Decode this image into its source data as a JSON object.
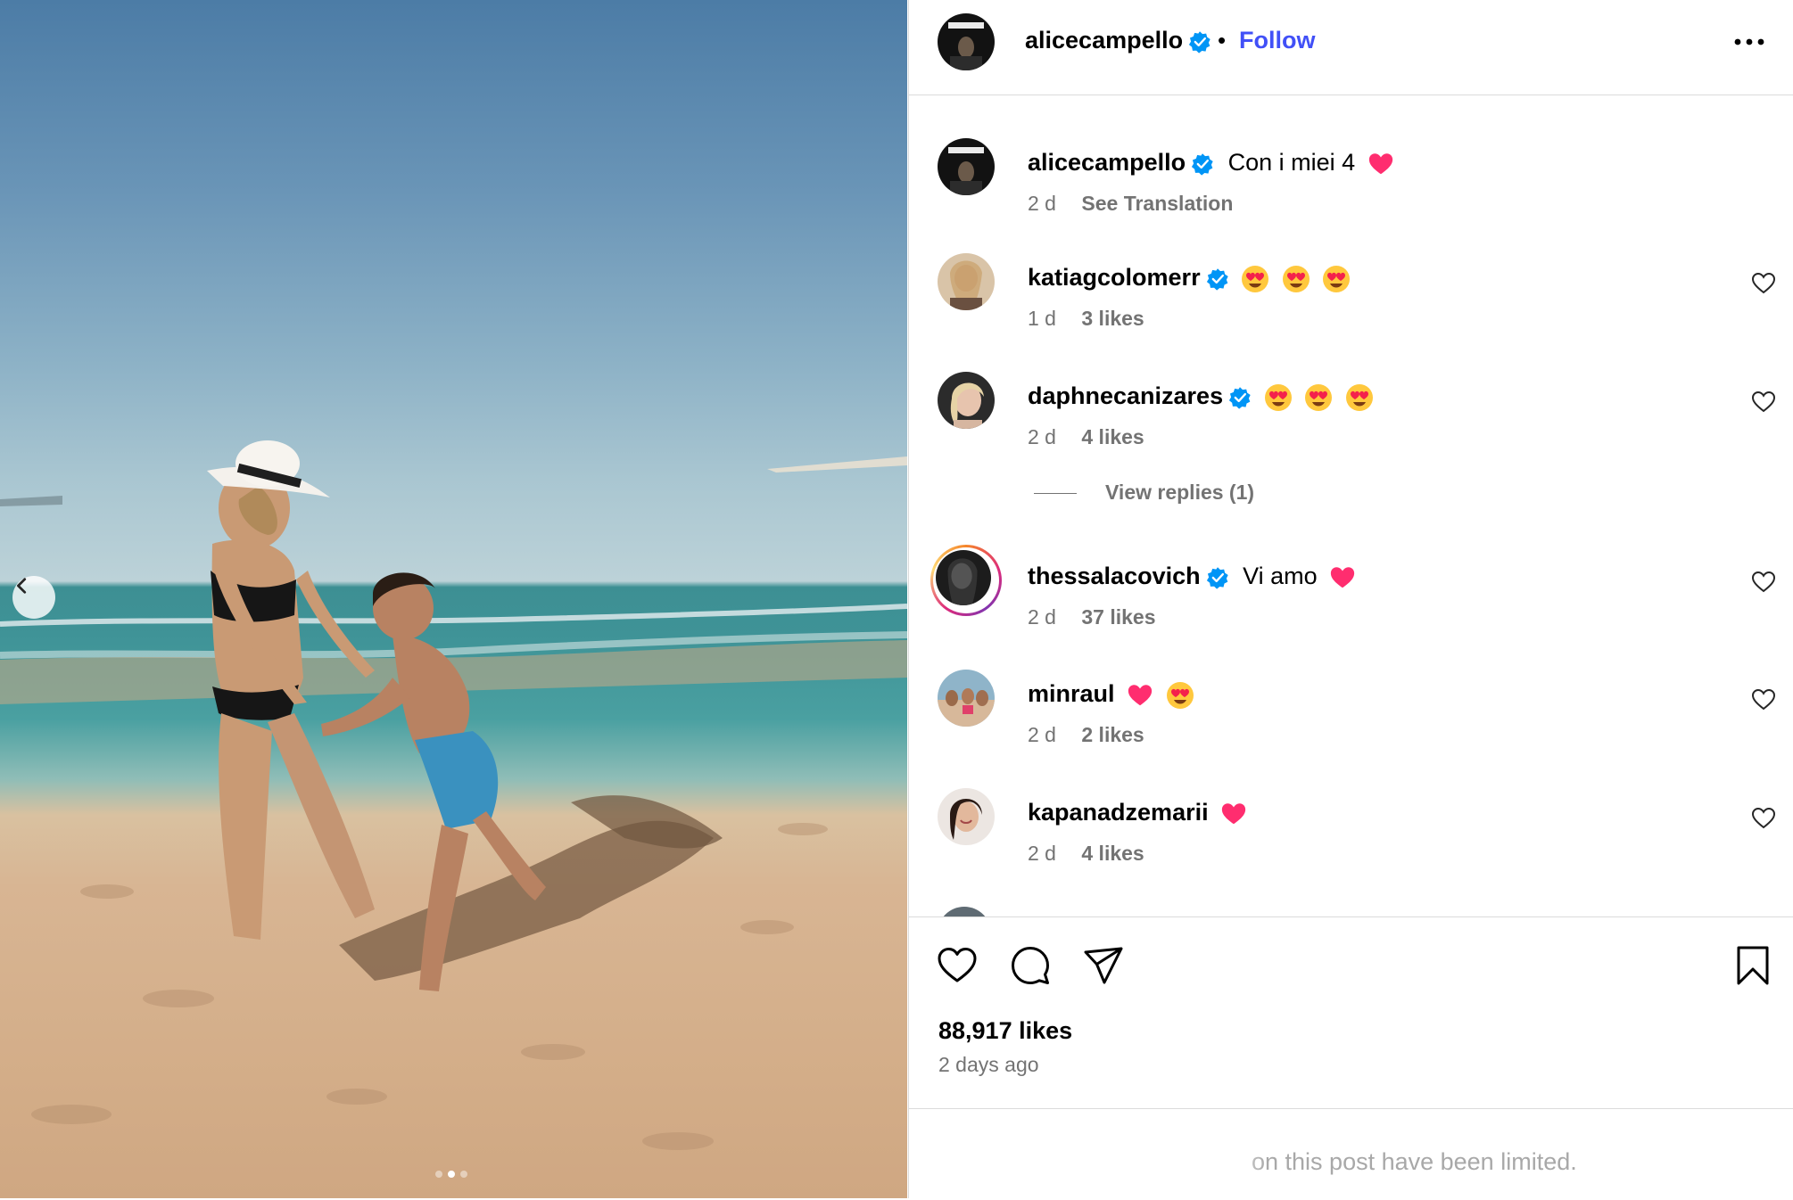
{
  "post": {
    "author": "alicecampello",
    "follow_label": "Follow",
    "caption_user": "alicecampello",
    "caption_text": "Con i miei 4",
    "caption_time": "2 d",
    "see_translation": "See Translation",
    "likes": "88,917 likes",
    "posted_ago": "2 days ago",
    "limited_notice": "on this post have been limited.",
    "carousel_slide": 2,
    "carousel_total": 3
  },
  "comments": [
    {
      "user": "katiagcolomerr",
      "text": "",
      "emojis": [
        "heart-eyes",
        "heart-eyes",
        "heart-eyes"
      ],
      "time": "1 d",
      "likes": "3 likes"
    },
    {
      "user": "daphnecanizares",
      "text": "",
      "emojis": [
        "heart-eyes",
        "heart-eyes",
        "heart-eyes"
      ],
      "time": "2 d",
      "likes": "4 likes",
      "replies": "View replies (1)"
    },
    {
      "user": "thessalacovich",
      "text": "Vi amo",
      "emojis": [
        "red-heart"
      ],
      "time": "2 d",
      "likes": "37 likes"
    },
    {
      "user": "minraul",
      "text": "",
      "emojis": [
        "red-heart",
        "heart-eyes"
      ],
      "time": "2 d",
      "likes": "2 likes"
    },
    {
      "user": "kapanadzemarii",
      "text": "",
      "emojis": [
        "red-heart"
      ],
      "time": "2 d",
      "likes": "4 likes"
    }
  ],
  "colors": {
    "follow": "#4150f7",
    "verified": "#0095f6",
    "muted": "#737373",
    "border": "#dbdbdb",
    "heart": "#ff2d6f"
  },
  "icons": [
    "chevron-left-icon",
    "more-icon",
    "verified-icon",
    "heart-outline-icon",
    "comment-icon",
    "share-icon",
    "bookmark-icon"
  ]
}
